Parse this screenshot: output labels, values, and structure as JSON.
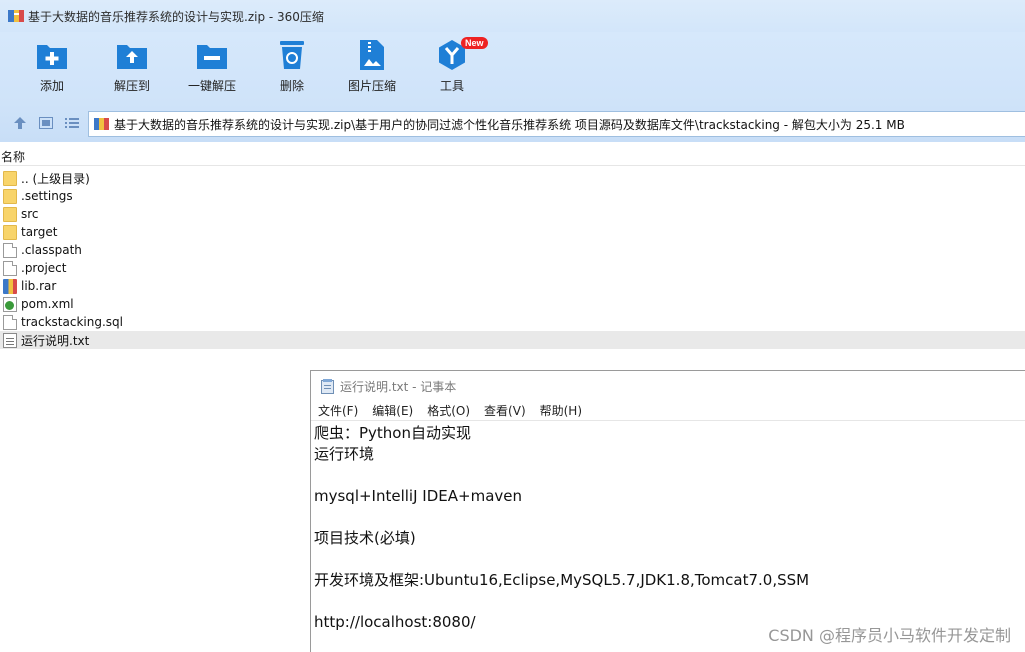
{
  "window": {
    "title": "基于大数据的音乐推荐系统的设计与实现.zip - 360压缩"
  },
  "toolbar": {
    "add_label": "添加",
    "extract_to_label": "解压到",
    "one_click_extract_label": "一键解压",
    "delete_label": "删除",
    "image_compress_label": "图片压缩",
    "tools_label": "工具",
    "new_badge": "New"
  },
  "navbar": {
    "path": "基于大数据的音乐推荐系统的设计与实现.zip\\基于用户的协同过滤个性化音乐推荐系统 项目源码及数据库文件\\trackstacking - 解包大小为 25.1 MB"
  },
  "filelist": {
    "column_name": "名称",
    "items": [
      {
        "name": ".. (上级目录)",
        "type": "folder"
      },
      {
        "name": ".settings",
        "type": "folder"
      },
      {
        "name": "src",
        "type": "folder"
      },
      {
        "name": "target",
        "type": "folder"
      },
      {
        "name": ".classpath",
        "type": "file"
      },
      {
        "name": ".project",
        "type": "file"
      },
      {
        "name": "lib.rar",
        "type": "rar"
      },
      {
        "name": "pom.xml",
        "type": "xml"
      },
      {
        "name": "trackstacking.sql",
        "type": "file"
      },
      {
        "name": "运行说明.txt",
        "type": "txt"
      }
    ]
  },
  "notepad": {
    "title": "运行说明.txt - 记事本",
    "menu": [
      "文件(F)",
      "编辑(E)",
      "格式(O)",
      "查看(V)",
      "帮助(H)"
    ],
    "lines": [
      "爬虫：Python自动实现",
      "运行环境",
      "",
      "mysql+IntelliJ IDEA+maven",
      "",
      "项目技术(必填)",
      "",
      "开发环境及框架:Ubuntu16,Eclipse,MySQL5.7,JDK1.8,Tomcat7.0,SSM",
      "",
      "http://localhost:8080/"
    ]
  },
  "watermark": "CSDN @程序员小马软件开发定制"
}
